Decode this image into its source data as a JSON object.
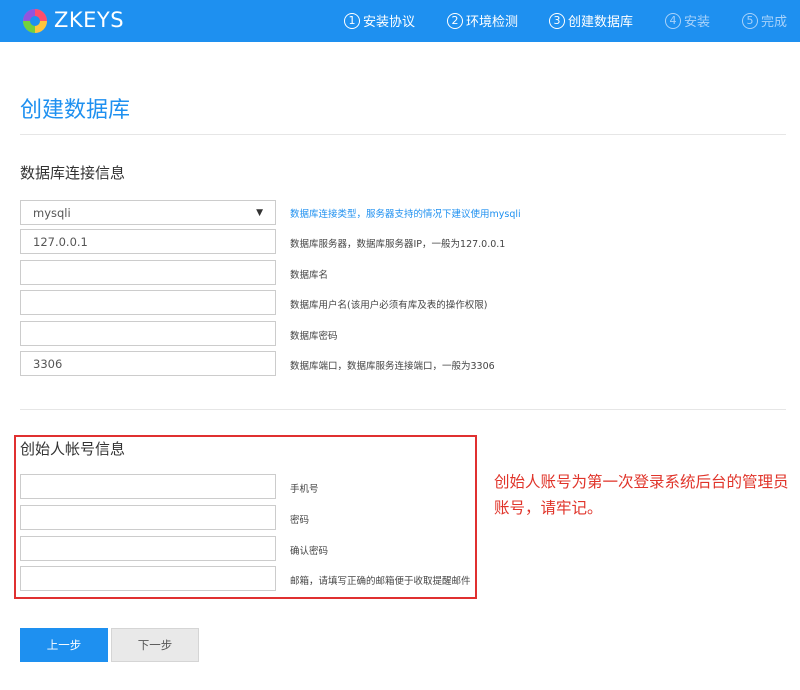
{
  "header": {
    "brand": "ZKEYS",
    "background_color": "#1e90f0",
    "steps": [
      {
        "num": "1",
        "label": "安装协议",
        "state": "done"
      },
      {
        "num": "2",
        "label": "环境检测",
        "state": "done"
      },
      {
        "num": "3",
        "label": "创建数据库",
        "state": "current"
      },
      {
        "num": "4",
        "label": "安装",
        "state": "future"
      },
      {
        "num": "5",
        "label": "完成",
        "state": "future"
      }
    ]
  },
  "page_title": "创建数据库",
  "db_section": {
    "title": "数据库连接信息",
    "fields": [
      {
        "type": "select",
        "value": "mysqli",
        "hint": "数据库连接类型，服务器支持的情况下建议使用mysqli",
        "hint_highlight": true
      },
      {
        "type": "text",
        "value": "127.0.0.1",
        "hint": "数据库服务器，数据库服务器IP，一般为127.0.0.1"
      },
      {
        "type": "text",
        "value": "",
        "hint": "数据库名"
      },
      {
        "type": "text",
        "value": "",
        "hint": "数据库用户名(该用户必须有库及表的操作权限)"
      },
      {
        "type": "password",
        "value": "",
        "hint": "数据库密码"
      },
      {
        "type": "text",
        "value": "3306",
        "hint": "数据库端口，数据库服务连接端口，一般为3306"
      }
    ]
  },
  "founder_section": {
    "title": "创始人帐号信息",
    "fields": [
      {
        "type": "text",
        "value": "",
        "hint": "手机号"
      },
      {
        "type": "password",
        "value": "",
        "hint": "密码"
      },
      {
        "type": "password",
        "value": "",
        "hint": "确认密码"
      },
      {
        "type": "text",
        "value": "",
        "hint": "邮箱，请填写正确的邮箱便于收取提醒邮件"
      }
    ]
  },
  "annotation": {
    "text": "创始人账号为第一次登录系统后台的管理员账号，请牢记。",
    "color": "#e0342a"
  },
  "buttons": {
    "prev_label": "上一步",
    "next_label": "下一步"
  },
  "icons": {
    "logo": "zkeys-logo-icon",
    "select_caret": "caret-down-icon"
  }
}
